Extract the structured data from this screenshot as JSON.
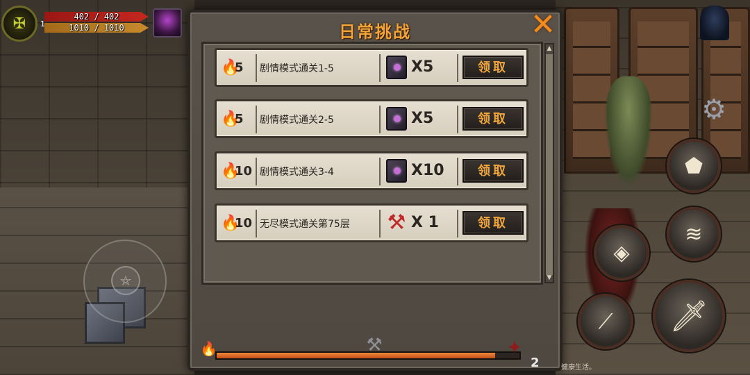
{
  "hud": {
    "level": "1",
    "hp_text": "402 / 402",
    "mp_text": "1010 / 1010",
    "emblem_icon": "guild-emblem-icon"
  },
  "panel": {
    "title": "日常挑战",
    "close_icon": "close-icon"
  },
  "tasks": [
    {
      "points": "5",
      "desc": "剧情模式通关1-5",
      "reward_icon": "spellbook-icon",
      "qty": "X5",
      "claim": "领取"
    },
    {
      "points": "5",
      "desc": "剧情模式通关2-5",
      "reward_icon": "spellbook-icon",
      "qty": "X5",
      "claim": "领取"
    },
    {
      "points": "10",
      "desc": "剧情模式通关3-4",
      "reward_icon": "spellbook-icon",
      "qty": "X10",
      "claim": "领取"
    },
    {
      "points": "10",
      "desc": "无尽模式通关第75层",
      "reward_icon": "axe-icon",
      "qty": "X 1",
      "claim": "领取"
    }
  ],
  "progress": {
    "fraction": 0.92,
    "end_count": "2"
  },
  "footer": {
    "text": "健康生活。"
  },
  "colors": {
    "accent": "#f0a43a",
    "flame": "#ec7a1a",
    "hp": "#c4281f",
    "mp": "#c78b2c"
  }
}
